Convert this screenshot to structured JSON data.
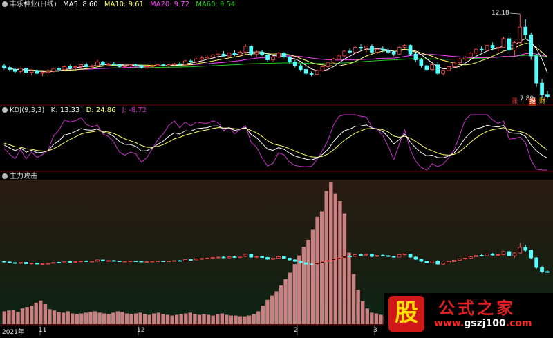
{
  "colors": {
    "up": "#ff4d4d",
    "down": "#54ffff",
    "ma5": "#ffffff",
    "ma10": "#ffff66",
    "ma20": "#ff44ff",
    "ma60": "#22cc22",
    "k": "#ffffff",
    "d": "#ffff66",
    "j": "#cc33cc",
    "grid": "#7a0000",
    "volume_bar": "#c98080"
  },
  "header_main": {
    "title": "丰乐种业(日线)",
    "ma5": "MA5: 8.60",
    "ma10": "MA10: 9.61",
    "ma20": "MA20: 9.72",
    "ma60": "MA60: 9.54"
  },
  "header_kdj": {
    "title": "KDJ(9,3,3)",
    "k": "K: 13.33",
    "d": "D: 24.86",
    "j": "J: -8.72"
  },
  "header_main_force": {
    "title": "主力攻击"
  },
  "price_annotations": {
    "high": "12.18",
    "low": "7.80"
  },
  "event_tags": {
    "zhang": "涨",
    "bao": "报",
    "cai": "财"
  },
  "x_axis_labels": {
    "year": "2021年",
    "m11": "11",
    "m12": "12",
    "m2": "2",
    "m3": "3"
  },
  "watermark": {
    "badge": "股",
    "name": "公式之家",
    "url_pre": "www.",
    "url_mid": "gszj100",
    "url_post": ".com"
  },
  "chart_data": [
    {
      "type": "candlestick",
      "title": "丰乐种业(日线)",
      "notes": "daily price candles with MA5 / MA10 / MA20 / MA60; high 12.18, low 7.80",
      "ylim": [
        7.6,
        12.4
      ],
      "series": [
        {
          "name": "MA5",
          "last": 8.6
        },
        {
          "name": "MA10",
          "last": 9.61
        },
        {
          "name": "MA20",
          "last": 9.72
        },
        {
          "name": "MA60",
          "last": 9.54
        }
      ],
      "candles": [
        [
          9.5,
          9.6,
          9.3,
          9.4
        ],
        [
          9.4,
          9.5,
          9.2,
          9.3
        ],
        [
          9.3,
          9.4,
          9.1,
          9.2
        ],
        [
          9.2,
          9.4,
          9.1,
          9.35
        ],
        [
          9.35,
          9.4,
          9.1,
          9.15
        ],
        [
          9.15,
          9.3,
          9.0,
          9.25
        ],
        [
          9.25,
          9.3,
          9.05,
          9.1
        ],
        [
          9.1,
          9.2,
          8.95,
          9.15
        ],
        [
          9.15,
          9.3,
          9.05,
          9.2
        ],
        [
          9.2,
          9.4,
          9.15,
          9.35
        ],
        [
          9.35,
          9.45,
          9.2,
          9.3
        ],
        [
          9.3,
          9.5,
          9.25,
          9.45
        ],
        [
          9.45,
          9.55,
          9.3,
          9.4
        ],
        [
          9.4,
          9.5,
          9.3,
          9.45
        ],
        [
          9.45,
          9.6,
          9.35,
          9.55
        ],
        [
          9.55,
          9.65,
          9.4,
          9.45
        ],
        [
          9.45,
          9.55,
          9.35,
          9.5
        ],
        [
          9.5,
          9.8,
          9.45,
          9.7
        ],
        [
          9.7,
          9.75,
          9.5,
          9.55
        ],
        [
          9.55,
          9.65,
          9.45,
          9.6
        ],
        [
          9.6,
          9.7,
          9.5,
          9.55
        ],
        [
          9.55,
          9.6,
          9.4,
          9.45
        ],
        [
          9.45,
          9.55,
          9.35,
          9.5
        ],
        [
          9.5,
          9.6,
          9.4,
          9.55
        ],
        [
          9.55,
          9.6,
          9.45,
          9.5
        ],
        [
          9.5,
          9.55,
          9.35,
          9.4
        ],
        [
          9.4,
          9.5,
          9.3,
          9.45
        ],
        [
          9.45,
          9.55,
          9.4,
          9.5
        ],
        [
          9.5,
          9.6,
          9.45,
          9.55
        ],
        [
          9.55,
          9.6,
          9.45,
          9.5
        ],
        [
          9.5,
          9.6,
          9.4,
          9.55
        ],
        [
          9.55,
          9.65,
          9.5,
          9.6
        ],
        [
          9.6,
          9.7,
          9.5,
          9.55
        ],
        [
          9.55,
          9.8,
          9.5,
          9.75
        ],
        [
          9.75,
          9.85,
          9.6,
          9.7
        ],
        [
          9.7,
          9.9,
          9.65,
          9.85
        ],
        [
          9.85,
          10.0,
          9.7,
          9.9
        ],
        [
          9.9,
          10.05,
          9.8,
          9.95
        ],
        [
          9.95,
          10.1,
          9.85,
          10.05
        ],
        [
          10.05,
          10.2,
          9.9,
          10.1
        ],
        [
          10.1,
          10.25,
          9.95,
          10.0
        ],
        [
          10.0,
          10.2,
          9.9,
          10.15
        ],
        [
          10.15,
          10.3,
          10.0,
          10.05
        ],
        [
          10.05,
          10.25,
          9.95,
          10.2
        ],
        [
          10.2,
          10.6,
          10.1,
          10.5
        ],
        [
          10.5,
          10.55,
          10.0,
          10.1
        ],
        [
          10.1,
          10.3,
          9.95,
          10.2
        ],
        [
          10.2,
          10.3,
          10.0,
          10.05
        ],
        [
          10.05,
          10.15,
          9.7,
          9.8
        ],
        [
          9.8,
          10.0,
          9.7,
          9.95
        ],
        [
          9.95,
          10.2,
          9.9,
          10.15
        ],
        [
          10.15,
          10.2,
          9.9,
          9.95
        ],
        [
          9.95,
          10.0,
          9.6,
          9.7
        ],
        [
          9.7,
          9.8,
          9.4,
          9.5
        ],
        [
          9.5,
          9.6,
          9.2,
          9.3
        ],
        [
          9.3,
          9.4,
          9.0,
          9.1
        ],
        [
          9.1,
          9.2,
          8.95,
          9.05
        ],
        [
          9.05,
          9.3,
          9.0,
          9.25
        ],
        [
          9.25,
          9.5,
          9.2,
          9.45
        ],
        [
          9.45,
          9.7,
          9.4,
          9.65
        ],
        [
          9.65,
          9.9,
          9.6,
          9.85
        ],
        [
          9.85,
          10.1,
          9.8,
          10.0
        ],
        [
          10.0,
          10.3,
          9.95,
          10.25
        ],
        [
          10.25,
          10.4,
          10.1,
          10.2
        ],
        [
          10.2,
          10.5,
          10.15,
          10.45
        ],
        [
          10.45,
          10.6,
          10.3,
          10.4
        ],
        [
          10.4,
          10.55,
          10.2,
          10.5
        ],
        [
          10.5,
          10.6,
          10.1,
          10.2
        ],
        [
          10.2,
          10.4,
          10.1,
          10.35
        ],
        [
          10.35,
          10.5,
          10.2,
          10.3
        ],
        [
          10.3,
          10.4,
          10.1,
          10.2
        ],
        [
          10.2,
          10.3,
          10.0,
          10.1
        ],
        [
          10.1,
          10.5,
          10.05,
          10.45
        ],
        [
          10.45,
          10.6,
          10.35,
          10.55
        ],
        [
          10.55,
          10.6,
          10.0,
          10.1
        ],
        [
          10.1,
          10.2,
          9.7,
          9.8
        ],
        [
          9.8,
          9.9,
          9.4,
          9.5
        ],
        [
          9.5,
          9.6,
          9.2,
          9.3
        ],
        [
          9.3,
          9.6,
          9.25,
          9.55
        ],
        [
          9.55,
          9.7,
          9.0,
          9.1
        ],
        [
          9.1,
          9.3,
          9.0,
          9.25
        ],
        [
          9.25,
          9.5,
          9.2,
          9.45
        ],
        [
          9.45,
          9.7,
          9.4,
          9.65
        ],
        [
          9.65,
          9.9,
          9.6,
          9.85
        ],
        [
          9.85,
          10.0,
          9.75,
          9.95
        ],
        [
          9.95,
          10.2,
          9.9,
          10.15
        ],
        [
          10.15,
          10.4,
          10.1,
          10.35
        ],
        [
          10.35,
          10.5,
          10.2,
          10.3
        ],
        [
          10.3,
          10.6,
          10.25,
          10.55
        ],
        [
          10.55,
          10.7,
          10.3,
          10.4
        ],
        [
          10.4,
          10.5,
          10.2,
          10.45
        ],
        [
          10.45,
          11.0,
          10.4,
          10.9
        ],
        [
          10.9,
          11.1,
          10.2,
          10.3
        ],
        [
          10.3,
          10.8,
          10.0,
          10.7
        ],
        [
          10.7,
          12.18,
          10.6,
          11.5
        ],
        [
          11.5,
          11.9,
          10.9,
          11.1
        ],
        [
          11.1,
          11.2,
          9.8,
          10.0
        ],
        [
          10.0,
          10.1,
          8.4,
          8.6
        ],
        [
          8.6,
          8.8,
          7.8,
          8.0
        ],
        [
          8.0,
          8.2,
          7.8,
          7.9
        ]
      ]
    },
    {
      "type": "line",
      "title": "KDJ(9,3,3)",
      "series": [
        {
          "name": "K",
          "last": 13.33
        },
        {
          "name": "D",
          "last": 24.86
        },
        {
          "name": "J",
          "last": -8.72
        }
      ]
    },
    {
      "type": "bar",
      "title": "主力攻击",
      "values": [
        18,
        19,
        20,
        17,
        22,
        24,
        26,
        30,
        33,
        28,
        21,
        19,
        17,
        16,
        18,
        15,
        14,
        15,
        16,
        17,
        18,
        16,
        15,
        14,
        16,
        18,
        17,
        15,
        14,
        15,
        16,
        14,
        13,
        15,
        16,
        14,
        13,
        12,
        13,
        14,
        15,
        16,
        14,
        13,
        14,
        13,
        12,
        14,
        15,
        13,
        12,
        12,
        11,
        11,
        12,
        14,
        18,
        26,
        34,
        40,
        46,
        54,
        63,
        72,
        84,
        96,
        108,
        118,
        132,
        150,
        158,
        186,
        198,
        183,
        172,
        155,
        100,
        70,
        48,
        32,
        22,
        16,
        15,
        13,
        12,
        13,
        14,
        12,
        11,
        12,
        11,
        10,
        10,
        11,
        12,
        11,
        12,
        11,
        10,
        12,
        11,
        10,
        11,
        10,
        12,
        11,
        10,
        12,
        10,
        11,
        24,
        12,
        11,
        10,
        13,
        11,
        12,
        10,
        15,
        22,
        30
      ]
    }
  ]
}
